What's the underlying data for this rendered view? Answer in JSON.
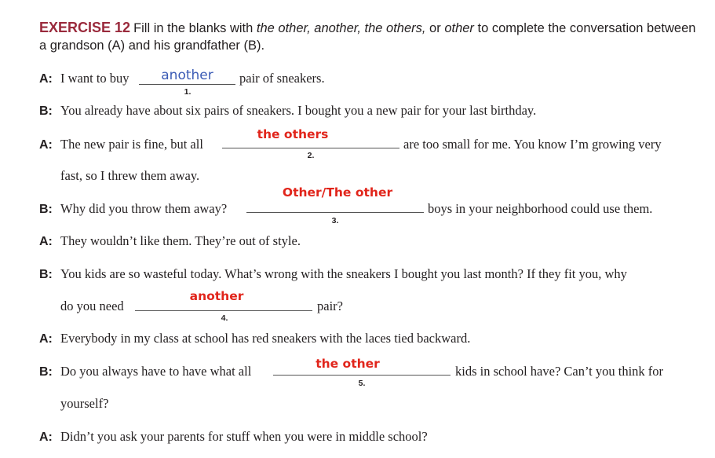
{
  "exercise": {
    "label": "EXERCISE 12",
    "instr_1": "Fill in the blanks with ",
    "opt_1": "the other, another, the others,",
    "instr_2": " or ",
    "opt_2": "other",
    "instr_3": " to complete the conversation between a grandson (A) and his grandfather (B)."
  },
  "dialogue": [
    {
      "speaker": "A:",
      "before": "I want to buy",
      "after": "pair of sneakers.",
      "number": "1.",
      "answer": "another"
    },
    {
      "speaker": "B:",
      "text": "You already have about six pairs of sneakers. I bought you a new pair for your last birthday."
    },
    {
      "speaker": "A:",
      "before": "The new pair is fine, but all",
      "after": "are too small for me. You know I’m growing very",
      "cont": "fast, so I threw them away.",
      "number": "2.",
      "answer": "the others"
    },
    {
      "speaker": "B:",
      "before": "Why did you throw them away?",
      "after": "boys in your neighborhood could use them.",
      "number": "3.",
      "answer": "Other/The other"
    },
    {
      "speaker": "A:",
      "text": "They wouldn’t like them. They’re out of style."
    },
    {
      "speaker": "B:",
      "text": "You kids are so wasteful today. What’s wrong with the sneakers I bought you last month? If they fit you, why",
      "cont_before": "do you need",
      "cont_after": "pair?",
      "number": "4.",
      "answer": "another"
    },
    {
      "speaker": "A:",
      "text": "Everybody in my class at school has red sneakers with the laces tied backward."
    },
    {
      "speaker": "B:",
      "before": "Do you always have to have what all",
      "after": "kids in school have? Can’t you think for",
      "cont": "yourself?",
      "number": "5.",
      "answer": "the other"
    },
    {
      "speaker": "A:",
      "text": "Didn’t you ask your parents for stuff when you were in middle school?"
    }
  ]
}
